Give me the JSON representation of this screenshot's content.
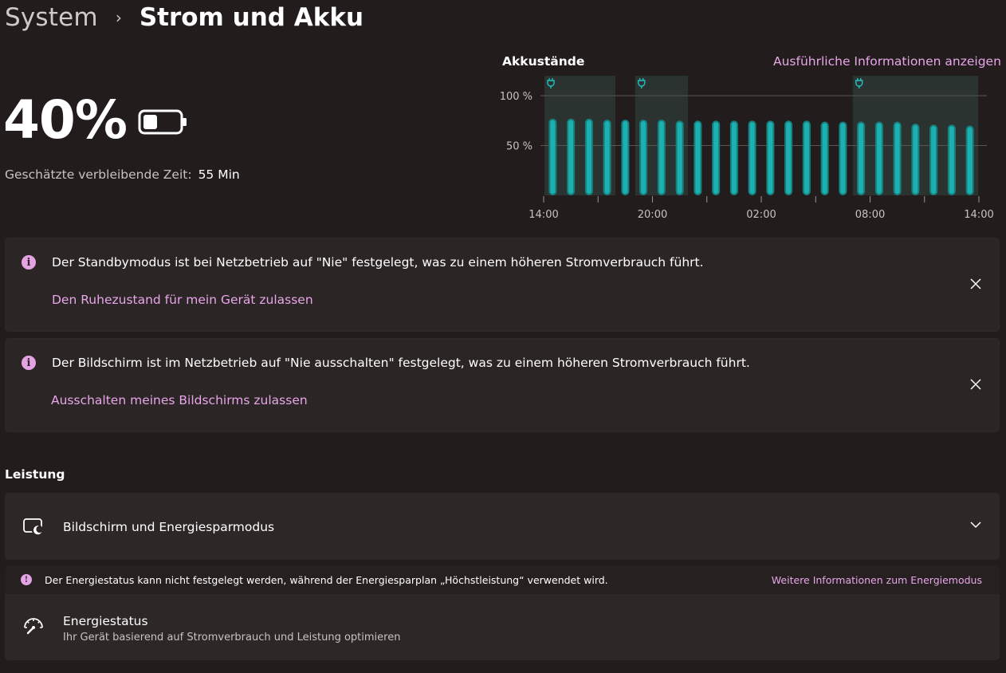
{
  "breadcrumb": {
    "parent": "System",
    "separator": "›",
    "current": "Strom und Akku"
  },
  "battery": {
    "percent_text": "40%",
    "level": 0.4,
    "remaining_label": "Geschätzte verbleibende Zeit:",
    "remaining_value": "55 Min"
  },
  "chart_header": {
    "title": "Akkustände",
    "details_link": "Ausführliche Informationen anzeigen"
  },
  "chart_data": {
    "type": "bar",
    "title": "Akkustände",
    "ylim": [
      0,
      120
    ],
    "y_ticks": [
      {
        "value": 100,
        "label": "100 %"
      },
      {
        "value": 50,
        "label": "50 %"
      }
    ],
    "x_ticks": [
      {
        "hour_index": 0,
        "label": "14:00"
      },
      {
        "hour_index": 6,
        "label": "20:00"
      },
      {
        "hour_index": 12,
        "label": "02:00"
      },
      {
        "hour_index": 18,
        "label": "08:00"
      },
      {
        "hour_index": 24,
        "label": "14:00"
      }
    ],
    "values": [
      77,
      77,
      77,
      76,
      76,
      76,
      76,
      75,
      75,
      75,
      75,
      75,
      75,
      75,
      75,
      74,
      74,
      74,
      74,
      74,
      72,
      71,
      71,
      70
    ],
    "charging_spans": [
      [
        0,
        4
      ],
      [
        5,
        8
      ],
      [
        17,
        24
      ]
    ],
    "grid": true,
    "colors": {
      "bar": "#1fb8b8",
      "bar_shade": "#16807f",
      "charging_bg": "#2b3330",
      "plug": "#24c0c0",
      "gridline": "#5a5453",
      "axis_text": "#c8c2c0"
    }
  },
  "notifications": [
    {
      "message": "Der Standbymodus ist bei Netzbetrieb auf \"Nie\" festgelegt, was zu einem höheren Stromverbrauch führt.",
      "link": "Den Ruhezustand für mein Gerät zulassen",
      "icon": "info-icon"
    },
    {
      "message": "Der Bildschirm ist im Netzbetrieb auf \"Nie ausschalten\" festgelegt, was zu einem höheren Stromverbrauch führt.",
      "link": "Ausschalten meines Bildschirms zulassen",
      "icon": "info-icon"
    }
  ],
  "performance": {
    "heading": "Leistung",
    "screen_sleep_label": "Bildschirm und Energiesparmodus",
    "notice_text": "Der Energiestatus kann nicht festgelegt werden, während der Energiesparplan „Höchstleistung“ verwendet wird.",
    "notice_link": "Weitere Informationen zum Energiemodus",
    "energy_title": "Energiestatus",
    "energy_desc": "Ihr Gerät basierend auf Stromverbrauch und Leistung optimieren"
  },
  "colors": {
    "accent": "#e8a5ea",
    "background": "#221d1c",
    "card": "#2b2625"
  }
}
